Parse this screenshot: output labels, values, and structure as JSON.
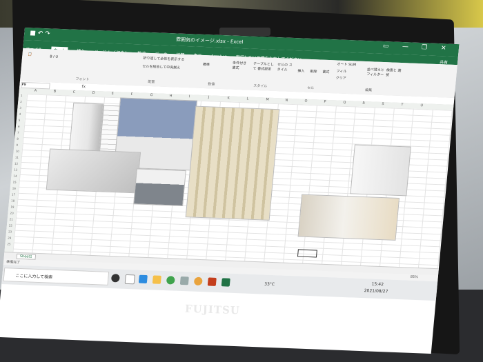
{
  "brand": "FUJITSU",
  "excel": {
    "title": "雰囲気のイメージ.xlsx - Excel",
    "tabs": [
      "ファイル",
      "ホーム",
      "挿入",
      "ページ レイアウト",
      "数式",
      "データ",
      "校閲",
      "表示",
      "Acrobat"
    ],
    "search_hint": "実行したい作業を入力してください",
    "share": "共有",
    "ribbon": {
      "autosum": "オート SUM",
      "fill": "フィル",
      "clear": "クリア",
      "sort_filter": "並べ替えと フィルター",
      "find_select": "検索と 選択",
      "group_edit": "編集",
      "group_cells": "セル",
      "insert": "挿入",
      "delete": "削除",
      "format": "書式",
      "cond_format": "条件付き 書式",
      "table_format": "テーブルとして 書式設定",
      "cell_style": "セルの スタイル",
      "group_style": "スタイル",
      "wrap": "折り返して全体を表示する",
      "merge": "セルを結合して中央揃え",
      "group_align": "配置",
      "group_number": "数値",
      "group_font": "フォント",
      "standard": "標準"
    },
    "namebox": "P9",
    "fx": "fx",
    "columns": [
      "A",
      "B",
      "C",
      "D",
      "E",
      "F",
      "G",
      "H",
      "I",
      "J",
      "K",
      "L",
      "M",
      "N",
      "O",
      "P",
      "Q",
      "R",
      "S",
      "T",
      "U"
    ],
    "rows": [
      "1",
      "2",
      "3",
      "4",
      "5",
      "6",
      "7",
      "8",
      "9",
      "10",
      "11",
      "12",
      "13",
      "14",
      "15",
      "16",
      "17",
      "18",
      "19",
      "20",
      "21",
      "22",
      "23",
      "24",
      "25"
    ],
    "sheet_tab": "Sheet1",
    "status_left": "準備完了",
    "zoom": "85%"
  },
  "taskbar": {
    "search_placeholder": "ここに入力して検索",
    "temperature": "33°C",
    "time": "15:42",
    "date": "2021/08/27"
  },
  "colors": {
    "excel_green": "#217346"
  }
}
